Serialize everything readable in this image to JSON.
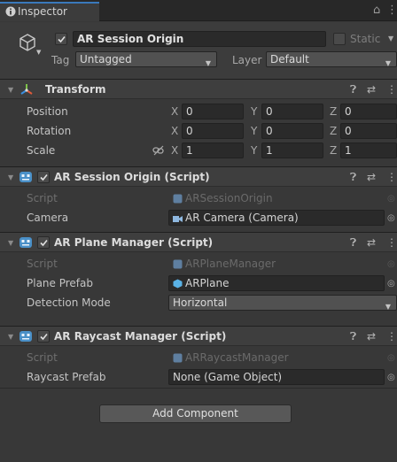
{
  "tab": {
    "title": "Inspector"
  },
  "header": {
    "object_name": "AR Session Origin",
    "static_label": "Static",
    "tag_label": "Tag",
    "tag_value": "Untagged",
    "layer_label": "Layer",
    "layer_value": "Default"
  },
  "transform": {
    "title": "Transform",
    "rows": [
      {
        "label": "Position",
        "x": "0",
        "y": "0",
        "z": "0"
      },
      {
        "label": "Rotation",
        "x": "0",
        "y": "0",
        "z": "0"
      },
      {
        "label": "Scale",
        "x": "1",
        "y": "1",
        "z": "1"
      }
    ],
    "axis": {
      "x": "X",
      "y": "Y",
      "z": "Z"
    }
  },
  "session_origin": {
    "title": "AR Session Origin (Script)",
    "script_label": "Script",
    "script_value": "ARSessionOrigin",
    "camera_label": "Camera",
    "camera_value": "AR Camera (Camera)"
  },
  "plane_manager": {
    "title": "AR Plane Manager (Script)",
    "script_label": "Script",
    "script_value": "ARPlaneManager",
    "prefab_label": "Plane Prefab",
    "prefab_value": "ARPlane",
    "mode_label": "Detection Mode",
    "mode_value": "Horizontal"
  },
  "raycast_manager": {
    "title": "AR Raycast Manager (Script)",
    "script_label": "Script",
    "script_value": "ARRaycastManager",
    "prefab_label": "Raycast Prefab",
    "prefab_value": "None (Game Object)"
  },
  "add_component_label": "Add Component",
  "colors": {
    "background": "#383838",
    "header": "#3e3e3e",
    "field": "#2a2a2a",
    "tab_accent": "#3a79bb"
  }
}
